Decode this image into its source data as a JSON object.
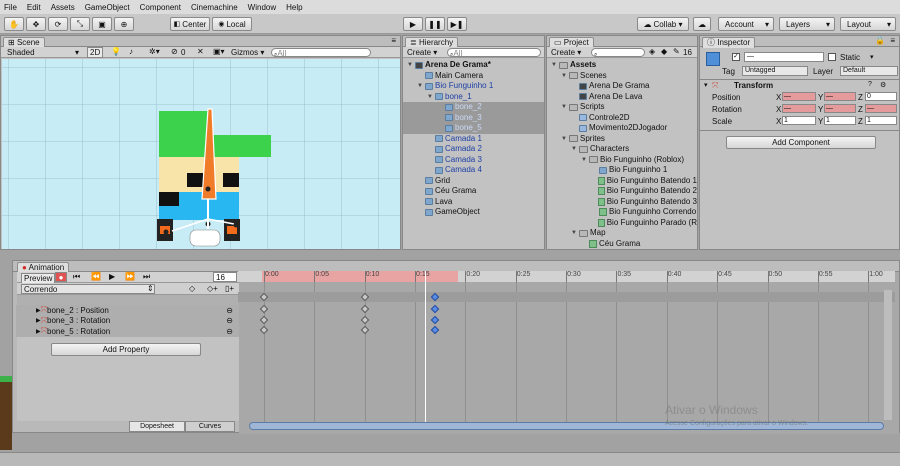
{
  "menu": [
    "File",
    "Edit",
    "Assets",
    "GameObject",
    "Component",
    "Cinemachine",
    "Window",
    "Help"
  ],
  "toolbar": {
    "center": "Center",
    "local": "Local",
    "collab": "Collab",
    "account": "Account",
    "layers": "Layers",
    "layout": "Layout"
  },
  "scene": {
    "tab": "Scene",
    "shading": "Shaded",
    "mode2d": "2D",
    "gizmos": "Gizmos",
    "search_placeholder": "All",
    "fx_count": "0"
  },
  "hierarchy": {
    "tab": "Hierarchy",
    "create": "Create",
    "search_placeholder": "All",
    "items": [
      {
        "label": "Arena De Grama*",
        "indent": 0,
        "type": "scene",
        "bold": true
      },
      {
        "label": "Main Camera",
        "indent": 1,
        "type": "go"
      },
      {
        "label": "Bio Funguinho 1",
        "indent": 1,
        "type": "go",
        "blue": true
      },
      {
        "label": "bone_1",
        "indent": 2,
        "type": "go",
        "blue": true
      },
      {
        "label": "bone_2",
        "indent": 3,
        "type": "go",
        "blue": true,
        "selected": true
      },
      {
        "label": "bone_3",
        "indent": 3,
        "type": "go",
        "blue": true,
        "selected": true
      },
      {
        "label": "bone_5",
        "indent": 3,
        "type": "go",
        "blue": true,
        "selected": true
      },
      {
        "label": "Camada 1",
        "indent": 2,
        "type": "go",
        "blue": true
      },
      {
        "label": "Camada 2",
        "indent": 2,
        "type": "go",
        "blue": true
      },
      {
        "label": "Camada 3",
        "indent": 2,
        "type": "go",
        "blue": true
      },
      {
        "label": "Camada 4",
        "indent": 2,
        "type": "go",
        "blue": true
      },
      {
        "label": "Grid",
        "indent": 1,
        "type": "go"
      },
      {
        "label": "Céu Grama",
        "indent": 1,
        "type": "go"
      },
      {
        "label": "Lava",
        "indent": 1,
        "type": "go"
      },
      {
        "label": "GameObject",
        "indent": 1,
        "type": "go"
      }
    ]
  },
  "project": {
    "tab": "Project",
    "create": "Create",
    "count": "16",
    "items": [
      {
        "label": "Assets",
        "indent": 0,
        "type": "folder",
        "bold": true
      },
      {
        "label": "Scenes",
        "indent": 1,
        "type": "folder"
      },
      {
        "label": "Arena De Grama",
        "indent": 2,
        "type": "scene"
      },
      {
        "label": "Arena De Lava",
        "indent": 2,
        "type": "scene"
      },
      {
        "label": "Scripts",
        "indent": 1,
        "type": "folder"
      },
      {
        "label": "Controle2D",
        "indent": 2,
        "type": "script"
      },
      {
        "label": "Movimento2DJogador",
        "indent": 2,
        "type": "script"
      },
      {
        "label": "Sprites",
        "indent": 1,
        "type": "folder"
      },
      {
        "label": "Characters",
        "indent": 2,
        "type": "folder"
      },
      {
        "label": "Bio Funguinho (Roblox)",
        "indent": 3,
        "type": "folder"
      },
      {
        "label": "Bio Funguinho 1",
        "indent": 4,
        "type": "prefab"
      },
      {
        "label": "Bio Funguinho Batendo 1",
        "indent": 4,
        "type": "sprite"
      },
      {
        "label": "Bio Funguinho Batendo 2",
        "indent": 4,
        "type": "sprite"
      },
      {
        "label": "Bio Funguinho Batendo 3",
        "indent": 4,
        "type": "sprite"
      },
      {
        "label": "Bio Funguinho Correndo",
        "indent": 4,
        "type": "sprite"
      },
      {
        "label": "Bio Funguinho Parado (R",
        "indent": 4,
        "type": "sprite"
      },
      {
        "label": "Map",
        "indent": 2,
        "type": "folder"
      },
      {
        "label": "Céu Grama",
        "indent": 3,
        "type": "sprite"
      }
    ]
  },
  "inspector": {
    "tab": "Inspector",
    "name_value": "—",
    "static_label": "Static",
    "tag_label": "Tag",
    "tag_value": "Untagged",
    "layer_label": "Layer",
    "layer_value": "Default",
    "component": "Transform",
    "position_label": "Position",
    "rotation_label": "Rotation",
    "scale_label": "Scale",
    "axis_x": "X",
    "axis_y": "Y",
    "axis_z": "Z",
    "position": {
      "x": "—",
      "y": "—",
      "z": "0"
    },
    "rotation": {
      "x": "—",
      "y": "—",
      "z": "—"
    },
    "scale": {
      "x": "1",
      "y": "1",
      "z": "1"
    },
    "add_component": "Add Component"
  },
  "animation": {
    "tab": "Animation",
    "preview": "Preview",
    "frame": "16",
    "clip": "Correndo",
    "properties": [
      "bone_2 : Position",
      "bone_3 : Rotation",
      "bone_5 : Rotation"
    ],
    "add_property": "Add Property",
    "dopesheet": "Dopesheet",
    "curves": "Curves",
    "ticks": [
      "0:00",
      "0:05",
      "0:10",
      "0:15",
      "0:20",
      "0:25",
      "0:30",
      "0:35",
      "0:40",
      "0:45",
      "0:50",
      "0:55",
      "1:00"
    ],
    "keyframe_frames": [
      0,
      10,
      17
    ],
    "playhead_frame": 15
  },
  "watermark": {
    "line1": "Ativar o Windows",
    "line2": "Acesse Configurações para ativar o Windows."
  },
  "colors": {
    "accent_blue": "#3a72d8",
    "record_red": "#d42a2a",
    "recording_pink": "#e8a3a3",
    "sky": "#c8ecf5",
    "hat_green": "#3cd24b"
  }
}
